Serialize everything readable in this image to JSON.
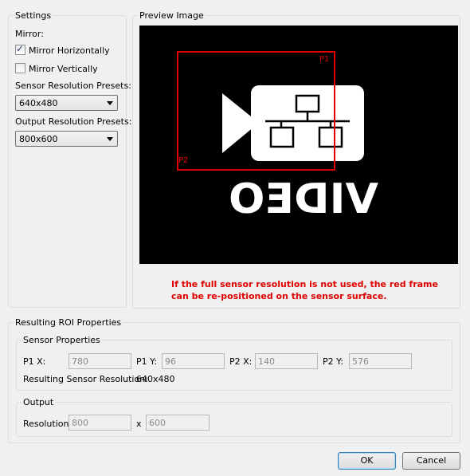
{
  "settings": {
    "title": "Settings",
    "mirror_label": "Mirror:",
    "mirror_h_label": "Mirror Horizontally",
    "mirror_h_checked": true,
    "mirror_v_label": "Mirror Vertically",
    "mirror_v_checked": false,
    "sensor_presets_label": "Sensor Resolution Presets:",
    "sensor_preset_value": "640x480",
    "output_presets_label": "Output Resolution Presets:",
    "output_preset_value": "800x600"
  },
  "preview": {
    "title": "Preview Image",
    "p1_label": "P1",
    "p2_label": "P2",
    "logo_text": "VIDEO",
    "frame_color": "#e00000",
    "hint": "If the full sensor resolution is not used, the red frame can be re-positioned on the sensor surface."
  },
  "roi": {
    "title": "Resulting ROI Properties",
    "sensor": {
      "title": "Sensor Properties",
      "p1x_label": "P1 X:",
      "p1x_value": "780",
      "p1y_label": "P1 Y:",
      "p1y_value": "96",
      "p2x_label": "P2 X:",
      "p2x_value": "140",
      "p2y_label": "P2 Y:",
      "p2y_value": "576",
      "resolution_label": "Resulting Sensor Resolution:",
      "resolution_value": "640x480"
    },
    "output": {
      "title": "Output",
      "resolution_label": "Resolution",
      "width_value": "800",
      "times": "x",
      "height_value": "600"
    }
  },
  "buttons": {
    "ok": "OK",
    "cancel": "Cancel"
  },
  "icons": {
    "checkmark": "checkmark-icon",
    "dropdown": "chevron-down-icon",
    "logo": "network-camera-icon"
  }
}
